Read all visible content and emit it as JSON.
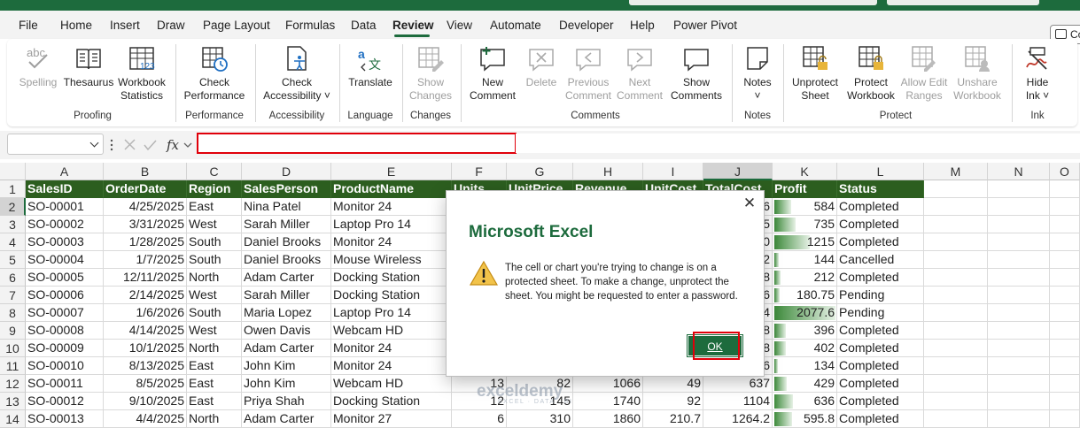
{
  "ribbon_tabs": [
    "File",
    "Home",
    "Insert",
    "Draw",
    "Page Layout",
    "Formulas",
    "Data",
    "Review",
    "View",
    "Automate",
    "Developer",
    "Help",
    "Power Pivot"
  ],
  "active_tab": "Review",
  "comments_button": "Co",
  "ribbon": {
    "spelling": "Spelling",
    "thesaurus": "Thesaurus",
    "workbook_statistics_1": "Workbook",
    "workbook_statistics_2": "Statistics",
    "group_proofing": "Proofing",
    "check_performance_1": "Check",
    "check_performance_2": "Performance",
    "group_performance": "Performance",
    "check_accessibility_1": "Check",
    "check_accessibility_2": "Accessibility ˅",
    "group_accessibility": "Accessibility",
    "translate": "Translate",
    "group_language": "Language",
    "show_changes_1": "Show",
    "show_changes_2": "Changes",
    "group_changes": "Changes",
    "new_comment_1": "New",
    "new_comment_2": "Comment",
    "delete": "Delete",
    "previous_comment_1": "Previous",
    "previous_comment_2": "Comment",
    "next_comment_1": "Next",
    "next_comment_2": "Comment",
    "show_comments_1": "Show",
    "show_comments_2": "Comments",
    "group_comments": "Comments",
    "notes_1": "Notes",
    "notes_2": "˅",
    "group_notes": "Notes",
    "unprotect_sheet_1": "Unprotect",
    "unprotect_sheet_2": "Sheet",
    "protect_workbook_1": "Protect",
    "protect_workbook_2": "Workbook",
    "allow_edit_ranges_1": "Allow Edit",
    "allow_edit_ranges_2": "Ranges",
    "unshare_workbook_1": "Unshare",
    "unshare_workbook_2": "Workbook",
    "group_protect": "Protect",
    "hide_ink_1": "Hide",
    "hide_ink_2": "Ink ˅",
    "group_ink": "Ink"
  },
  "formula_bar": {
    "fx": "fx",
    "name_box": "",
    "formula": ""
  },
  "columns": [
    "A",
    "B",
    "C",
    "D",
    "E",
    "F",
    "G",
    "H",
    "I",
    "J",
    "K",
    "L",
    "M",
    "N",
    "O"
  ],
  "row_numbers": [
    "1",
    "2",
    "3",
    "4",
    "5",
    "6",
    "7",
    "8",
    "9",
    "10",
    "11",
    "12",
    "13",
    "14"
  ],
  "table_headers": [
    "SalesID",
    "OrderDate",
    "Region",
    "SalesPerson",
    "ProductName",
    "Units",
    "UnitPrice",
    "Revenue",
    "UnitCost",
    "TotalCost",
    "Profit",
    "Status"
  ],
  "rows": [
    {
      "id": "SO-00001",
      "date": "4/25/2025",
      "region": "East",
      "person": "Nina Patel",
      "product": "Monitor 24",
      "units": "",
      "price": "",
      "revenue": "",
      "ucost": "",
      "tcost": "6",
      "profit": "584",
      "status": "Completed"
    },
    {
      "id": "SO-00002",
      "date": "3/31/2025",
      "region": "West",
      "person": "Sarah Miller",
      "product": "Laptop Pro 14",
      "units": "",
      "price": "",
      "revenue": "",
      "ucost": "",
      "tcost": "5",
      "profit": "735",
      "status": "Completed"
    },
    {
      "id": "SO-00003",
      "date": "1/28/2025",
      "region": "South",
      "person": "Daniel Brooks",
      "product": "Monitor 24",
      "units": "",
      "price": "",
      "revenue": "",
      "ucost": "",
      "tcost": "0",
      "profit": "1215",
      "status": "Completed"
    },
    {
      "id": "SO-00004",
      "date": "1/7/2025",
      "region": "South",
      "person": "Daniel Brooks",
      "product": "Mouse Wireless",
      "units": "",
      "price": "",
      "revenue": "",
      "ucost": "",
      "tcost": "2",
      "profit": "144",
      "status": "Cancelled"
    },
    {
      "id": "SO-00005",
      "date": "12/11/2025",
      "region": "North",
      "person": "Adam Carter",
      "product": "Docking Station",
      "units": "",
      "price": "",
      "revenue": "",
      "ucost": "",
      "tcost": "8",
      "profit": "212",
      "status": "Completed"
    },
    {
      "id": "SO-00006",
      "date": "2/14/2025",
      "region": "West",
      "person": "Sarah Miller",
      "product": "Docking Station",
      "units": "",
      "price": "",
      "revenue": "",
      "ucost": "",
      "tcost": "6",
      "profit": "180.75",
      "status": "Pending"
    },
    {
      "id": "SO-00007",
      "date": "1/6/2026",
      "region": "South",
      "person": "Maria Lopez",
      "product": "Laptop Pro 14",
      "units": "",
      "price": "",
      "revenue": "",
      "ucost": "",
      "tcost": "4",
      "profit": "2077.6",
      "status": "Pending"
    },
    {
      "id": "SO-00008",
      "date": "4/14/2025",
      "region": "West",
      "person": "Owen Davis",
      "product": "Webcam HD",
      "units": "",
      "price": "",
      "revenue": "",
      "ucost": "",
      "tcost": "8",
      "profit": "396",
      "status": "Completed"
    },
    {
      "id": "SO-00009",
      "date": "10/1/2025",
      "region": "North",
      "person": "Adam Carter",
      "product": "Monitor 24",
      "units": "",
      "price": "",
      "revenue": "",
      "ucost": "",
      "tcost": "8",
      "profit": "402",
      "status": "Completed"
    },
    {
      "id": "SO-00010",
      "date": "8/13/2025",
      "region": "East",
      "person": "John Kim",
      "product": "Monitor 24",
      "units": "",
      "price": "",
      "revenue": "",
      "ucost": "",
      "tcost": "6",
      "profit": "134",
      "status": "Completed"
    },
    {
      "id": "SO-00011",
      "date": "8/5/2025",
      "region": "East",
      "person": "John Kim",
      "product": "Webcam HD",
      "units": "13",
      "price": "82",
      "revenue": "1066",
      "ucost": "49",
      "tcost": "637",
      "profit": "429",
      "status": "Completed"
    },
    {
      "id": "SO-00012",
      "date": "9/10/2025",
      "region": "East",
      "person": "Priya Shah",
      "product": "Docking Station",
      "units": "12",
      "price": "145",
      "revenue": "1740",
      "ucost": "92",
      "tcost": "1104",
      "profit": "636",
      "status": "Completed"
    },
    {
      "id": "SO-00013",
      "date": "4/4/2025",
      "region": "North",
      "person": "Adam Carter",
      "product": "Monitor 27",
      "units": "6",
      "price": "310",
      "revenue": "1860",
      "ucost": "210.7",
      "tcost": "1264.2",
      "profit": "595.8",
      "status": "Completed"
    }
  ],
  "profit_bar_max": 2077.6,
  "dialog": {
    "title": "Microsoft Excel",
    "message": "The cell or chart you're trying to change is on a protected sheet. To make a change, unprotect the sheet. You might be requested to enter a password.",
    "ok": "OK",
    "close": "✕"
  },
  "watermark": {
    "name": "exceldemy",
    "tagline": "EXCEL · DATA · BI"
  },
  "colors": {
    "accent": "#1d6b3d",
    "header_fill": "#2c5e1f",
    "highlight": "#e0000a"
  }
}
